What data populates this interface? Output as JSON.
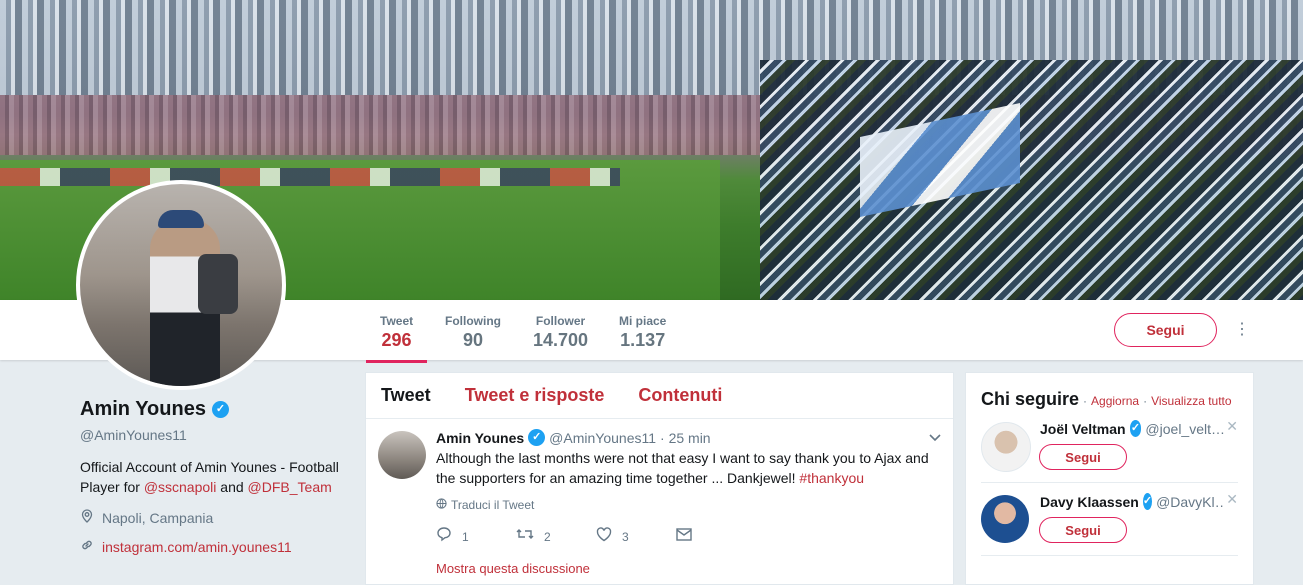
{
  "profile": {
    "name": "Amin Younes",
    "handle": "@AminYounes11",
    "bio_prefix": "Official Account of Amin Younes - Football Player for ",
    "bio_link1": "@sscnapoli",
    "bio_mid": " and ",
    "bio_link2": "@DFB_Team",
    "location": "Napoli, Campania",
    "website": "instagram.com/amin.younes11"
  },
  "stats": [
    {
      "label": "Tweet",
      "value": "296"
    },
    {
      "label": "Following",
      "value": "90"
    },
    {
      "label": "Follower",
      "value": "14.700"
    },
    {
      "label": "Mi piace",
      "value": "1.137"
    }
  ],
  "follow_label": "Segui",
  "more_icon": "⋮",
  "tabs": [
    "Tweet",
    "Tweet e risposte",
    "Contenuti"
  ],
  "tweet": {
    "name": "Amin Younes",
    "handle": "@AminYounes11",
    "time": "· 25 min",
    "text": "Although the last months were not that easy I want to say thank you to Ajax and the supporters for an amazing time together ... Dankjewel! ",
    "hashtag": "#thankyou",
    "translate": "Traduci il Tweet",
    "replies": "1",
    "retweets": "2",
    "likes": "3",
    "thread": "Mostra questa discussione"
  },
  "who_to_follow": {
    "title": "Chi seguire",
    "sep": "·",
    "refresh": "Aggiorna",
    "view_all": "Visualizza tutto",
    "users": [
      {
        "name": "Joël Veltman",
        "handle": "@joel_velt…",
        "button": "Segui",
        "avatar_color": "#e8e8e8"
      },
      {
        "name": "Davy Klaassen",
        "handle": "@DavyKl…",
        "button": "Segui",
        "avatar_color": "#1d4f91"
      }
    ]
  },
  "colors": {
    "accent": "#e0245e",
    "link": "#c0303a",
    "verified": "#1da1f2"
  }
}
